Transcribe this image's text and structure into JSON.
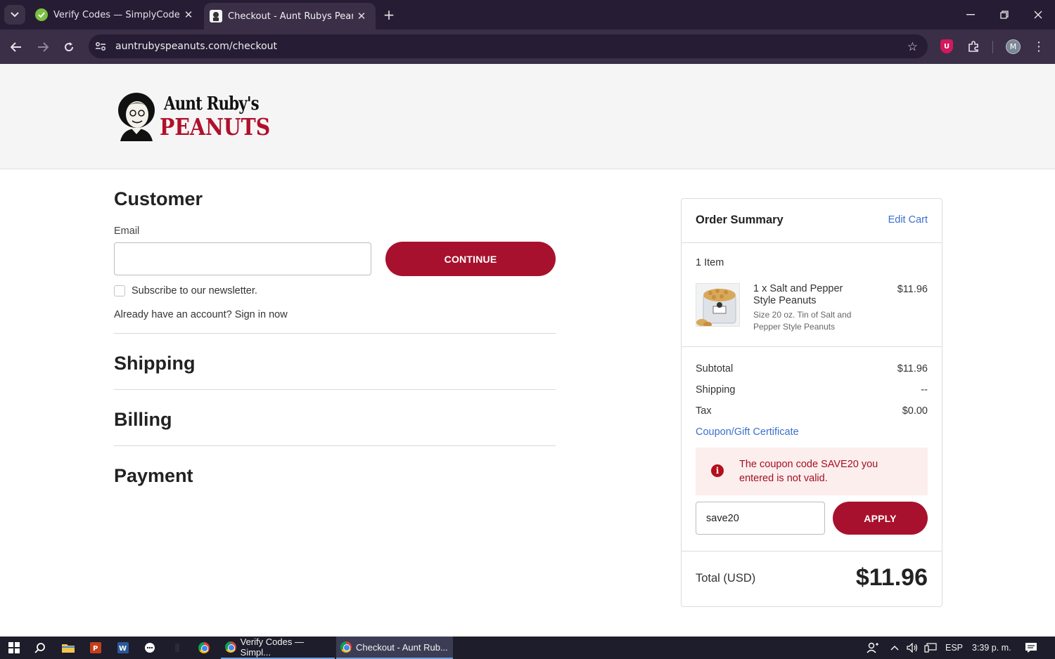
{
  "browser": {
    "tabs": [
      {
        "title": "Verify Codes — SimplyCodes",
        "active": false
      },
      {
        "title": "Checkout - Aunt Rubys Peanuts",
        "active": true
      }
    ],
    "url": "auntrubyspeanuts.com/checkout",
    "profile_initial": "M",
    "extension_badge": "U"
  },
  "brand": {
    "line1": "Aunt Ruby's",
    "line2": "PEANUTS",
    "accent_color": "#a8112d"
  },
  "customer": {
    "title": "Customer",
    "email_label": "Email",
    "email_value": "",
    "continue_label": "CONTINUE",
    "newsletter_label": "Subscribe to our newsletter.",
    "newsletter_checked": false,
    "account_prompt": "Already have an account?",
    "sign_in_label": "Sign in now"
  },
  "sections": {
    "shipping": "Shipping",
    "billing": "Billing",
    "payment": "Payment"
  },
  "order_summary": {
    "title": "Order Summary",
    "edit_cart_label": "Edit Cart",
    "item_count": "1 Item",
    "item": {
      "name_line1": "1 x Salt and Pepper",
      "name_line2": "Style Peanuts",
      "desc_line1": "Size 20 oz. Tin of Salt and",
      "desc_line2": "Pepper Style Peanuts",
      "price": "$11.96"
    },
    "subtotal_label": "Subtotal",
    "subtotal_value": "$11.96",
    "shipping_label": "Shipping",
    "shipping_value": "--",
    "tax_label": "Tax",
    "tax_value": "$0.00",
    "coupon_link": "Coupon/Gift Certificate",
    "error_line1": "The coupon code SAVE20 you",
    "error_line2": "entered is not valid.",
    "coupon_value": "save20",
    "apply_label": "APPLY",
    "total_label": "Total (USD)",
    "total_value": "$11.96"
  },
  "taskbar": {
    "apps": [
      {
        "label": "Verify Codes — Simpl...",
        "active": false
      },
      {
        "label": "Checkout - Aunt Rub...",
        "active": true
      }
    ],
    "language": "ESP",
    "clock": "3:39 p. m."
  }
}
